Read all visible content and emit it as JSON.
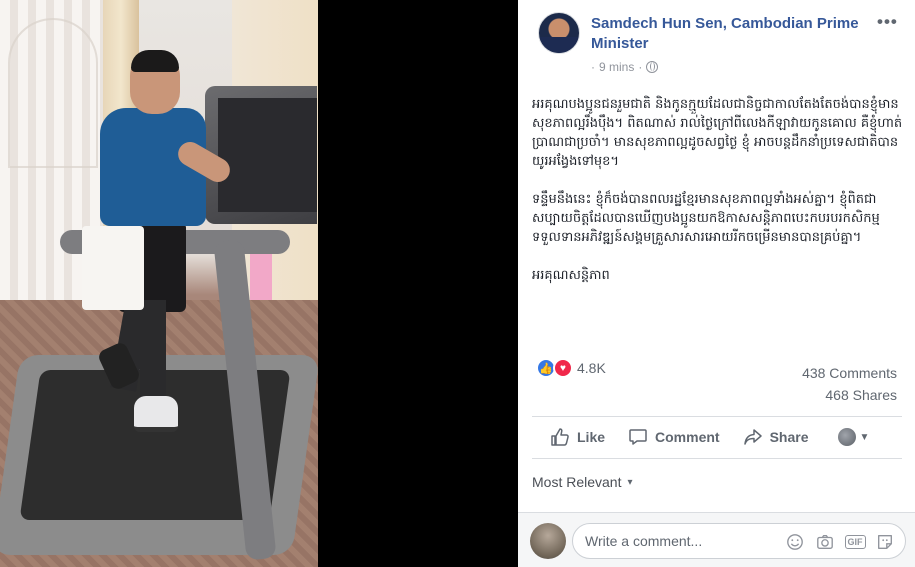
{
  "post": {
    "author": "Samdech Hun Sen, Cambodian Prime Minister",
    "time": "9 mins",
    "time_prefix": "·",
    "paragraphs": [
      "អរគុណបងប្អូនជនរួមជាតិ និងកូនក្មួយដែលជានិច្ចជាកាលតែងតែចង់បានខ្ញុំមានសុខភាពល្អរឹងប៉ឹង។ ពិតណាស់ រាល់ថ្ងៃក្រៅពីលេងកីឡាវាយកូនគោល គឺខ្ញុំហាត់ប្រាណជាប្រចាំ។ មានសុខភាពល្អដូចសព្វថ្ងៃ ខ្ញុំ អាចបន្តដឹកនាំប្រទេសជាតិបានយូរអង្វែងទៅមុខ។",
      "ទន្ទឹមនឹងនេះ ខ្ញុំក៏ចង់បានពលរដ្ឋខ្មែរមានសុខភាពល្អទាំងអស់គ្នា។ ខ្ញុំពិតជាសប្បាយចិត្តដែលបានឃើញបងប្អូនយកឱកាសសន្តិភាពបេះកបរបរកសិកម្មទទួលទានអភិវឌ្ឍន៍សង្គមគ្រួសារសារអោយរីកចម្រើនមានបានគ្រប់គ្នា។",
      "អរគុណសន្តិភាព"
    ]
  },
  "stats": {
    "reaction_count": "4.8K",
    "comments": "438 Comments",
    "shares": "468 Shares"
  },
  "actions": {
    "like": "Like",
    "comment": "Comment",
    "share": "Share"
  },
  "sort": {
    "label": "Most Relevant"
  },
  "composer": {
    "placeholder": "Write a comment...",
    "gif": "GIF"
  },
  "icons": {
    "more": "more-options-icon",
    "globe": "public-globe-icon",
    "like": "thumbs-up-icon",
    "comment": "speech-bubble-icon",
    "share": "share-arrow-icon",
    "emoji": "emoji-icon",
    "camera": "camera-icon",
    "sticker": "sticker-icon"
  },
  "colors": {
    "link": "#365899",
    "like_reaction": "#3578e5",
    "love_reaction": "#f0284a",
    "muted": "#606770"
  }
}
